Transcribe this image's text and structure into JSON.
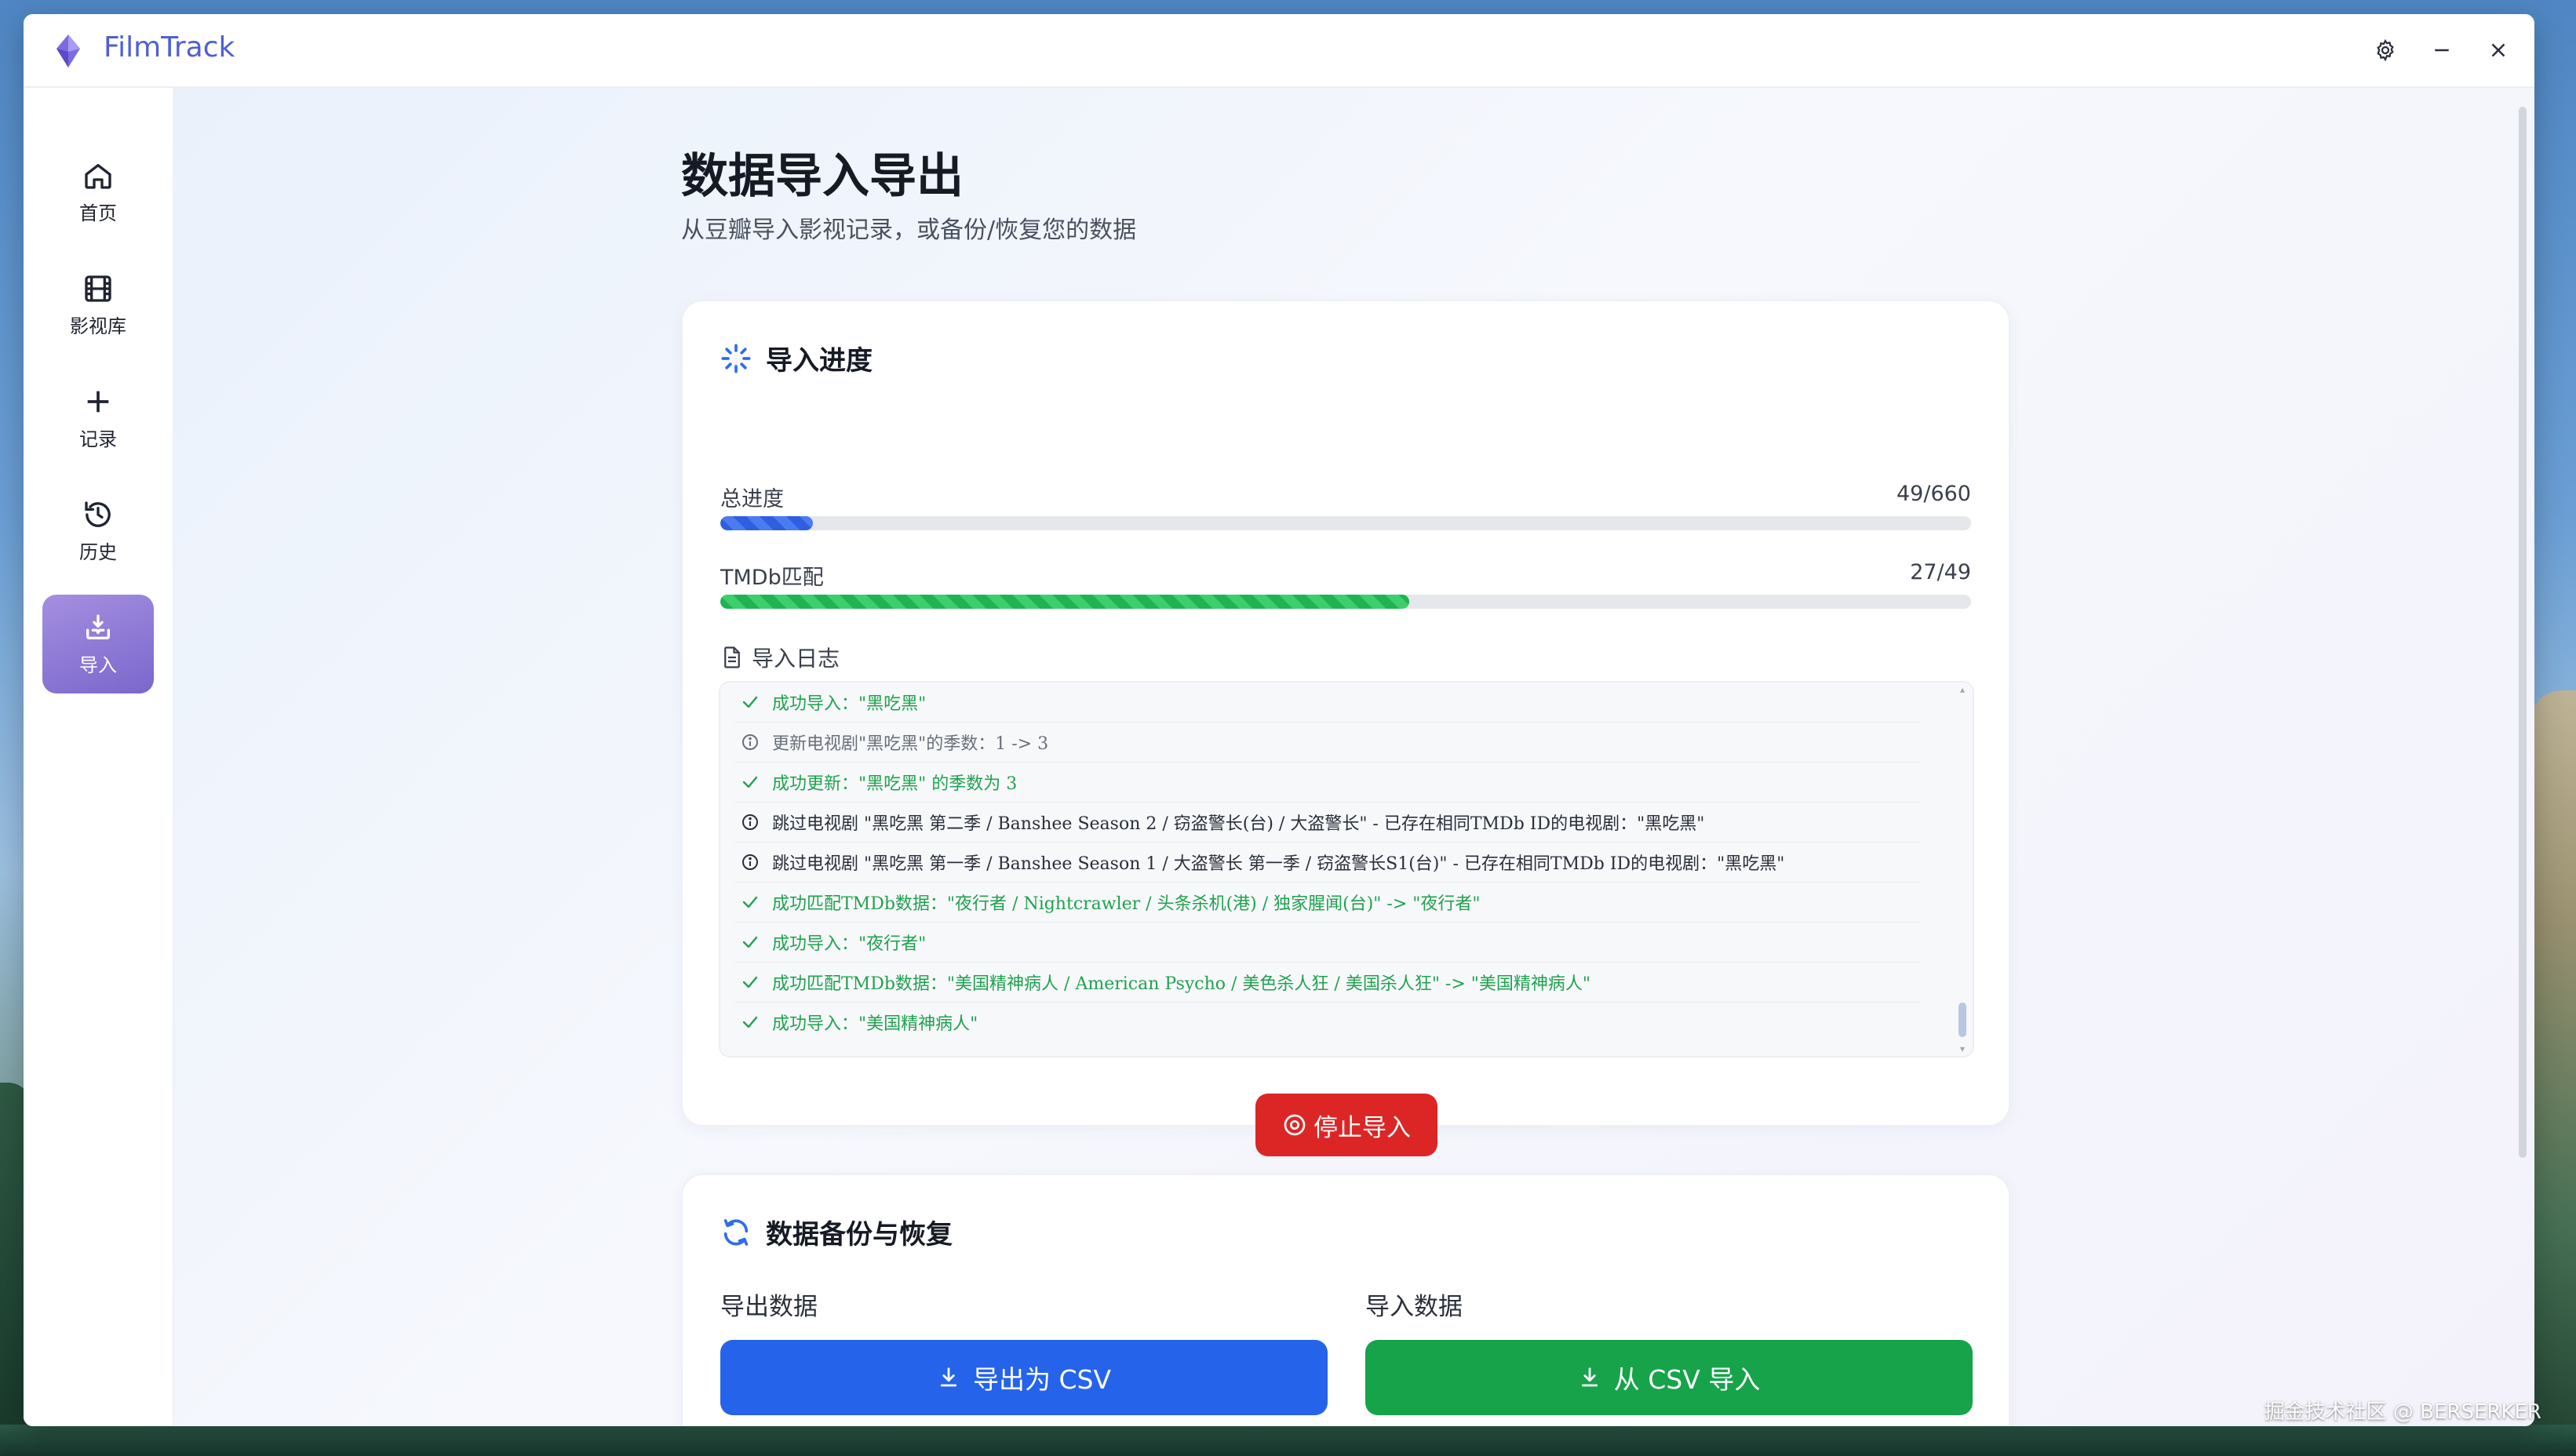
{
  "app": {
    "title": "FilmTrack"
  },
  "sidebar": {
    "items": [
      {
        "label": "首页",
        "icon": "home-icon"
      },
      {
        "label": "影视库",
        "icon": "film-icon"
      },
      {
        "label": "记录",
        "icon": "plus-icon"
      },
      {
        "label": "历史",
        "icon": "history-icon"
      },
      {
        "label": "导入",
        "icon": "import-icon",
        "active": true
      }
    ]
  },
  "page": {
    "title": "数据导入导出",
    "subtitle": "从豆瓣导入影视记录，或备份/恢复您的数据"
  },
  "import_progress": {
    "title": "导入进度",
    "total": {
      "label": "总进度",
      "value": "49/660",
      "fraction": 0.0742
    },
    "tmdb": {
      "label": "TMDb匹配",
      "value": "27/49",
      "fraction": 0.551
    },
    "log_title": "导入日志",
    "log": [
      {
        "type": "success",
        "text": "成功导入：\"黑吃黑\""
      },
      {
        "type": "info-muted",
        "text": "更新电视剧\"黑吃黑\"的季数：1 -> 3"
      },
      {
        "type": "success",
        "text": "成功更新：\"黑吃黑\" 的季数为 3"
      },
      {
        "type": "info",
        "text": "跳过电视剧 \"黑吃黑 第二季 / Banshee Season 2 / 窃盗警长(台) / 大盗警长\" - 已存在相同TMDb ID的电视剧：\"黑吃黑\""
      },
      {
        "type": "info",
        "text": "跳过电视剧 \"黑吃黑 第一季 / Banshee Season 1 / 大盗警长 第一季 / 窃盗警长S1(台)\" - 已存在相同TMDb ID的电视剧：\"黑吃黑\""
      },
      {
        "type": "success",
        "text": "成功匹配TMDb数据：\"夜行者 / Nightcrawler / 头条杀机(港) / 独家腥闻(台)\" -> \"夜行者\""
      },
      {
        "type": "success",
        "text": "成功导入：\"夜行者\""
      },
      {
        "type": "success",
        "text": "成功匹配TMDb数据：\"美国精神病人 / American Psycho / 美色杀人狂 / 美国杀人狂\" -> \"美国精神病人\""
      },
      {
        "type": "success",
        "text": "成功导入：\"美国精神病人\""
      }
    ],
    "stop_label": "停止导入"
  },
  "backup": {
    "title": "数据备份与恢复",
    "export_label": "导出数据",
    "import_label": "导入数据",
    "export_button": "导出为 CSV",
    "import_button": "从 CSV 导入"
  },
  "watermark": "掘金技术社区 @ BERSERKER",
  "colors": {
    "accent": "#4f5fd5",
    "active_nav": "#8b78d6",
    "success": "#1fa24f",
    "danger": "#dc2626",
    "primary": "#2563eb",
    "green_button": "#16a34a"
  }
}
